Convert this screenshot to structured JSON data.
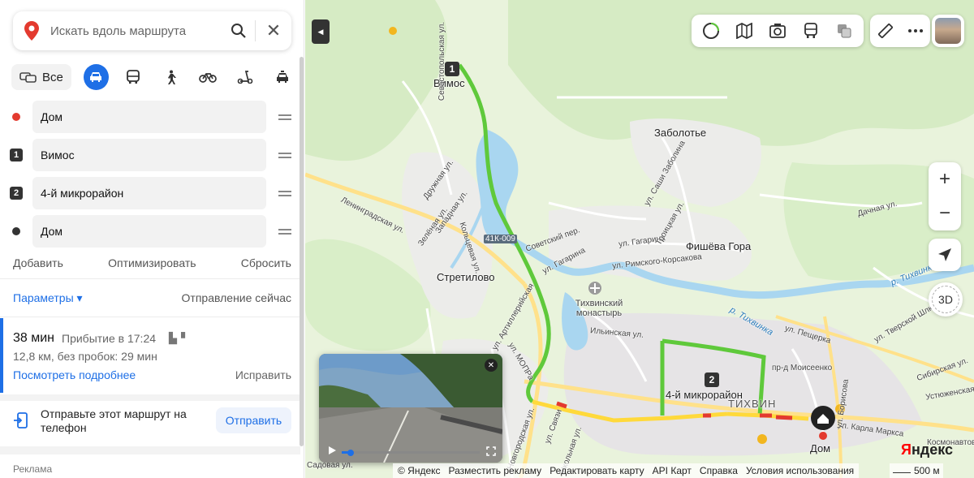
{
  "search": {
    "placeholder": "Искать вдоль маршрута",
    "icon": "search-icon",
    "close_icon": "close-icon"
  },
  "modes": {
    "all_label": "Все",
    "active": "car",
    "items": [
      "car",
      "bus",
      "walk",
      "bike",
      "scooter",
      "taxi"
    ]
  },
  "waypoints": [
    {
      "marker": "dot",
      "color": "#e33a2f",
      "value": "Дом"
    },
    {
      "marker": "num",
      "label": "1",
      "value": "Вимос"
    },
    {
      "marker": "num",
      "label": "2",
      "value": "4-й микрорайон"
    },
    {
      "marker": "dot",
      "color": "#333333",
      "value": "Дом"
    }
  ],
  "actions": {
    "add": "Добавить",
    "optimize": "Оптимизировать",
    "reset": "Сбросить"
  },
  "params": {
    "label": "Параметры ▾",
    "departure": "Отправление сейчас"
  },
  "route": {
    "duration": "38 мин",
    "arrival": "Прибытие в 17:24",
    "details": "12,8 км, без пробок: 29 мин",
    "more_link": "Посмотреть подробнее",
    "fix_link": "Исправить"
  },
  "send": {
    "text": "Отправьте этот маршрут на телефон",
    "button": "Отправить"
  },
  "ads_label": "Реклама",
  "map": {
    "labels": {
      "vimos": "Вимос",
      "zabolotye": "Заболотье",
      "stretilovo": "Стретилово",
      "fisheva_gora": "Фишёва Гора",
      "monastery": "Тихвинский монастырь",
      "microdistrict": "4-й микрорайон",
      "tikhvin": "Тихвин",
      "home": "Дом",
      "road_code": "41К-009",
      "leningradskaya": "Ленинградская ул.",
      "druzhnaya": "Дружная ул.",
      "zapadnaya": "Западная ул.",
      "zelenaya": "Зелёная ул.",
      "koltsevaya": "Кольцевая ул.",
      "sovetsky": "Советский пер.",
      "gagarina": "ул. Гагарина",
      "gagarina2": "ул. Гагарина",
      "rimsky": "ул. Римского-Корсакова",
      "ilyinskaya": "Ильинская ул.",
      "peshcherka": "ул. Пещерка",
      "karla_marksa": "ул. Карла Маркса",
      "moiseenko": "пр-д Моисеенко",
      "dachnaya": "Дачная ул.",
      "tverskoy": "ул. Тверской Шлюз",
      "sibirskaya": "Сибирская ул.",
      "ustyuzhenskaya": "Устюженская ул.",
      "tikhvinka": "р. Тихвинка",
      "tikhvinka2": "р. Тихвинка",
      "mopra": "ул. МОПРа",
      "svyazi": "ул. Связи",
      "novgorodskaya": "Новгородская ул.",
      "shkolnaya": "Школьная ул.",
      "sadovaya": "Садовая ул.",
      "artilleriyskaya": "ул. Артиллерийская",
      "sashi_zabelina": "ул. Саши Заболина",
      "troitskaya": "Троицкая ул.",
      "borisova": "ул. Борисова",
      "sevastopol": "Севастопольская ул.",
      "kosmonavtov": "Космонавтов"
    },
    "route_badges": [
      "1",
      "2"
    ],
    "toolbar_icons": [
      "traffic-icon",
      "layers-map-icon",
      "panorama-icon",
      "transit-icon",
      "layers-icon",
      "ruler-icon",
      "more-icon"
    ],
    "zoom_in": "+",
    "zoom_out": "−",
    "btn_3d": "3D",
    "brand": {
      "main": "Я",
      "rest": "ндекс"
    },
    "footer": [
      "© Яндекс",
      "Разместить рекламу",
      "Редактировать карту",
      "API Карт",
      "Справка",
      "Условия использования"
    ],
    "scale": "500 м",
    "colors": {
      "route_green": "#5fc93b",
      "route_yellow": "#ffd93b",
      "route_red": "#e33a2f",
      "water": "#a9d6f0",
      "accent": "#1e6fe6"
    }
  }
}
